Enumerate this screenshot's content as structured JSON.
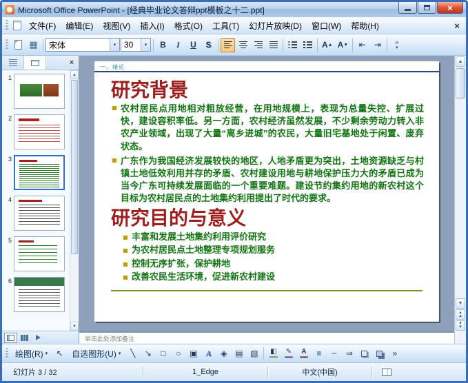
{
  "window": {
    "title": "Microsoft Office PowerPoint - [经典毕业论文答辩ppt模板之十二.ppt]"
  },
  "colors": {
    "fill": "#ffcc00",
    "line": "#7030a0",
    "font": "#cc0000"
  },
  "icons": {
    "close_x": "×",
    "dropdown": "▾",
    "chevron": "»",
    "grid": "▦",
    "bold": "B",
    "italic": "I",
    "underline": "U",
    "shadow_s": "S",
    "letter_a": "A",
    "up_arrow": "▲",
    "down_arrow": "▼",
    "indent_dec": "⇤",
    "indent_inc": "⇥",
    "pointer": "↖",
    "line": "╲",
    "arrow": "↘",
    "rectangle": "□",
    "oval": "○",
    "textbox": "▣",
    "wordart": "A",
    "diagram": "◈",
    "clipart": "▤",
    "picture": "▧",
    "fill_bucket": "◧",
    "pencil": "✎",
    "line_style": "≡",
    "dash_style": "┄",
    "arrow_style": "⇒"
  },
  "menu": {
    "items": [
      "文件(F)",
      "编辑(E)",
      "视图(V)",
      "插入(I)",
      "格式(O)",
      "工具(T)",
      "幻灯片放映(D)",
      "窗口(W)",
      "帮助(H)"
    ]
  },
  "toolbar": {
    "font_name": "宋体",
    "font_size": "30"
  },
  "panel": {
    "thumbs": [
      "1",
      "2",
      "3",
      "4",
      "5",
      "6"
    ]
  },
  "slide": {
    "header": "一、绪论",
    "title1": "研究背景",
    "bullets1": [
      "农村居民点用地相对粗放经营，在用地规模上，表现为总量失控、扩展过快，建设容积率低。另一方面，农村经济虽然发展，不少剩余劳动力转入非农产业领域，出现了大量“离乡进城”的农民，大量旧宅基地处于闲置、废弃状态。",
      "广东作为我国经济发展较快的地区，人地矛盾更为突出，土地资源缺乏与村镇土地低效利用并存的矛盾、农村建设用地与耕地保护压力大的矛盾已成为当今广东可持续发展面临的一个重要难题。建设节约集约用地的新农村这个目标为农村居民点的土地集约利用提出了时代的要求。"
    ],
    "title2": "研究目的与意义",
    "bullets2": [
      "丰富和发展土地集约利用评价研究",
      "为农村居民点土地整理专项规划服务",
      "控制无序扩张，保护耕地",
      "改善农民生活环境，促进新农村建设"
    ]
  },
  "notes": {
    "placeholder": "单击此处添加备注"
  },
  "drawing": {
    "draw": "绘图(R)",
    "autoshapes": "自选图形(U)"
  },
  "status": {
    "slide_info": "幻灯片 3 / 32",
    "design": "1_Edge",
    "language": "中文(中国)"
  }
}
